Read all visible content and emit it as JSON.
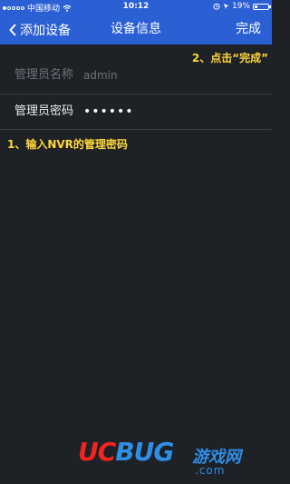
{
  "status_bar": {
    "carrier": "中国移动",
    "time": "10:12",
    "battery_percent": "19%",
    "battery_level": 0.19,
    "signal_dots_filled": 1,
    "signal_dots_total": 5
  },
  "nav": {
    "back_label": "添加设备",
    "title": "设备信息",
    "done_label": "完成",
    "bar_color": "#2b5fd4"
  },
  "form": {
    "username_label": "管理员名称",
    "username_value": "admin",
    "password_label": "管理员密码",
    "password_value": "••••••"
  },
  "annotations": {
    "step2": "2、点击“完成”",
    "step1": "1、输入NVR的管理密码",
    "color": "#ffd83a"
  },
  "watermark": {
    "uc": "UC",
    "bug": "BUG",
    "cn": "游戏网",
    "dotcom": ".com"
  }
}
